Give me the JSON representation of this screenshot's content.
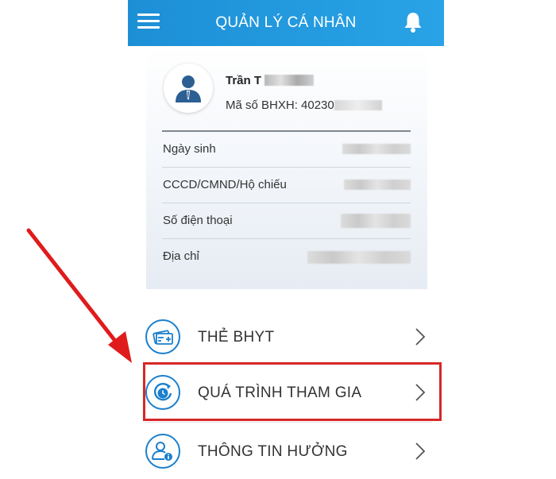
{
  "header": {
    "title": "QUẢN LÝ CÁ NHÂN",
    "menu_icon": "hamburger-menu-icon",
    "bell_icon": "bell-icon"
  },
  "profile": {
    "avatar_icon": "user-avatar-icon",
    "name": "Trần T",
    "bhxh_label": "Mã số BHXH:",
    "bhxh_number": "40230"
  },
  "info_rows": [
    {
      "label": "Ngày sinh"
    },
    {
      "label": "CCCD/CMND/Hộ chiếu"
    },
    {
      "label": "Số điện thoại"
    },
    {
      "label": "Địa chỉ"
    }
  ],
  "menu": [
    {
      "label": "THẺ BHYT",
      "icon": "health-card-icon"
    },
    {
      "label": "QUÁ TRÌNH THAM GIA",
      "icon": "history-clock-icon"
    },
    {
      "label": "THÔNG TIN HƯỞNG",
      "icon": "user-info-icon"
    }
  ],
  "colors": {
    "header_start": "#1d8fd6",
    "header_end": "#29a3e6",
    "icon_blue": "#1b7fcc",
    "highlight_red": "#d62828"
  }
}
